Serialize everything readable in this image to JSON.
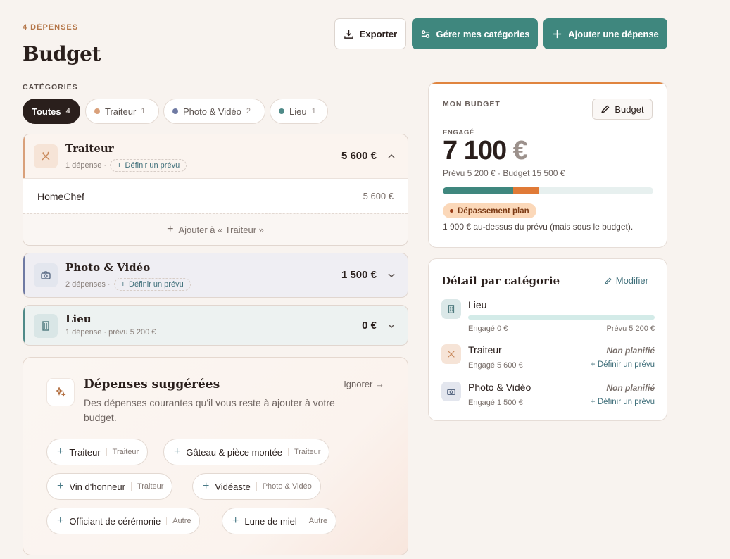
{
  "header": {
    "count": "4 DÉPENSES",
    "title": "Budget",
    "export": "Exporter",
    "manage": "Gérer mes catégories",
    "add": "Ajouter une dépense"
  },
  "categories": {
    "label": "CATÉGORIES",
    "pills": [
      {
        "label": "Toutes",
        "count": "4"
      },
      {
        "label": "Traiteur",
        "count": "1",
        "color": "#d9a07a"
      },
      {
        "label": "Photo & Vidéo",
        "count": "2",
        "color": "#6f7aa3"
      },
      {
        "label": "Lieu",
        "count": "1",
        "color": "#4f8a88"
      }
    ]
  },
  "cards": {
    "traiteur": {
      "name": "Traiteur",
      "meta": "1 dépense ·",
      "define": "Définir un prévu",
      "amount": "5 600 €",
      "color": "#d9a07a",
      "items": [
        {
          "name": "HomeChef",
          "amount": "5 600 €"
        }
      ],
      "add": "Ajouter à « Traiteur »"
    },
    "photo": {
      "name": "Photo & Vidéo",
      "meta": "2 dépenses ·",
      "define": "Définir un prévu",
      "amount": "1 500 €",
      "color": "#6f7aa3"
    },
    "lieu": {
      "name": "Lieu",
      "meta": "1 dépense · prévu 5 200 €",
      "amount": "0 €",
      "color": "#4f8a88"
    }
  },
  "suggestions": {
    "title": "Dépenses suggérées",
    "desc": "Des dépenses courantes qu'il vous reste à ajouter à votre budget.",
    "ignore": "Ignorer →",
    "chips": [
      {
        "label": "Traiteur",
        "tag": "Traiteur"
      },
      {
        "label": "Gâteau & pièce montée",
        "tag": "Traiteur"
      },
      {
        "label": "Vin d'honneur",
        "tag": "Traiteur"
      },
      {
        "label": "Vidéaste",
        "tag": "Photo & Vidéo"
      },
      {
        "label": "Officiant de cérémonie",
        "tag": "Autre"
      },
      {
        "label": "Lune de miel",
        "tag": "Autre"
      }
    ]
  },
  "budget": {
    "label": "MON BUDGET",
    "button": "Budget",
    "engaged_label": "ENGAGÉ",
    "engaged_value": "7 100",
    "currency": "€",
    "sub": "Prévu 5 200 € · Budget 15 500 €",
    "progress": {
      "engaged_fraction": 0.458,
      "planned_fraction": 0.335
    },
    "warning": "Dépassement plan",
    "note": "1 900 € au-dessus du prévu (mais sous le budget)."
  },
  "detail": {
    "title": "Détail par catégorie",
    "modify": "Modifier",
    "items": [
      {
        "name": "Lieu",
        "engaged": "Engagé 0 €",
        "planned": "Prévu 5 200 €"
      },
      {
        "name": "Traiteur",
        "status": "Non planifié",
        "engaged": "Engagé 5 600 €",
        "link": "Définir un prévu"
      },
      {
        "name": "Photo & Vidéo",
        "status": "Non planifié",
        "engaged": "Engagé 1 500 €",
        "link": "Définir un prévu"
      }
    ]
  }
}
